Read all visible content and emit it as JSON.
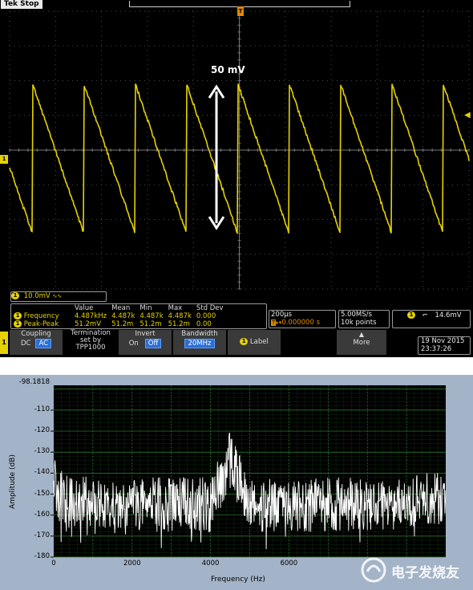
{
  "scope": {
    "status": "Tek Stop",
    "annotation": "50 mV",
    "channel_scale": "10.0mV",
    "meas_headers": [
      "Value",
      "Mean",
      "Min",
      "Max",
      "Std Dev"
    ],
    "meas_rows": [
      {
        "name": "Frequency",
        "value": "4.487kHz",
        "mean": "4.487k",
        "min": "4.487k",
        "max": "4.487k",
        "std": "0.000"
      },
      {
        "name": "Peak-Peak",
        "value": "51.2mV",
        "mean": "51.2m",
        "min": "51.2m",
        "max": "51.2m",
        "std": "0.00"
      }
    ],
    "timebase": "200µs",
    "trigger_pos": "0.000000 s",
    "sample_rate": "5.00MS/s",
    "record_length": "10k points",
    "trigger_level": "14.6mV",
    "date": "19 Nov 2015",
    "time": "23:37:26",
    "softkeys": {
      "coupling_title": "Coupling",
      "coupling_dc": "DC",
      "coupling_ac": "AC",
      "termination_l1": "Termination",
      "termination_l2": "set by",
      "termination_l3": "TPP1000",
      "invert_title": "Invert",
      "invert_on": "On",
      "invert_off": "Off",
      "bandwidth_title": "Bandwidth",
      "bandwidth_value": "20MHz",
      "label": "Label",
      "more": "More"
    },
    "channel_number": "1",
    "trace_color": "#e6d200"
  },
  "fft": {
    "y_top_label": "-98.1818",
    "y_ticks": [
      "-110",
      "-120",
      "-130",
      "-140",
      "-150",
      "-160",
      "-170",
      "-180"
    ],
    "x_ticks": [
      "0",
      "2000",
      "4000",
      "6000"
    ],
    "xlabel": "Frequency (Hz)",
    "ylabel": "Amplitude (dB)",
    "grid_color": "#2f8a2f"
  },
  "watermark": "电子发烧友",
  "chart_data": {
    "type": "line",
    "title": "",
    "xlabel": "Frequency (Hz)",
    "ylabel": "Amplitude (dB)",
    "xlim": [
      0,
      10000
    ],
    "ylim": [
      -180,
      -98.1818
    ],
    "series": [
      {
        "values_description_free": true,
        "x": [
          0,
          100,
          500,
          1000,
          2000,
          3000,
          4000,
          4487,
          5000,
          6000,
          7000,
          8000,
          9000,
          10000
        ],
        "y": [
          -130,
          -138,
          -141,
          -142,
          -142,
          -142,
          -142,
          -121,
          -142,
          -142,
          -142,
          -142,
          -142,
          -138
        ]
      }
    ],
    "grid": true
  }
}
